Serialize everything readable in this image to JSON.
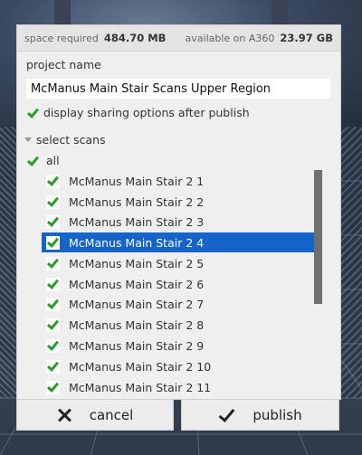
{
  "storage": {
    "required_label": "space required",
    "required_value": "484.70 MB",
    "available_label": "available on A360",
    "available_value": "23.97 GB"
  },
  "project": {
    "label": "project name",
    "value": "McManus Main Stair Scans Upper Region"
  },
  "sharing": {
    "label": "display sharing options after publish",
    "checked": true
  },
  "scans": {
    "header": "select scans",
    "all_label": "all",
    "items": [
      {
        "label": "McManus Main Stair 2 1",
        "checked": true
      },
      {
        "label": "McManus Main Stair 2 2",
        "checked": true
      },
      {
        "label": "McManus Main Stair 2 3",
        "checked": true
      },
      {
        "label": "McManus Main Stair 2 4",
        "checked": true,
        "selected": true
      },
      {
        "label": "McManus Main Stair 2 5",
        "checked": true
      },
      {
        "label": "McManus Main Stair 2 6",
        "checked": true
      },
      {
        "label": "McManus Main Stair 2 7",
        "checked": true
      },
      {
        "label": "McManus Main Stair 2 8",
        "checked": true
      },
      {
        "label": "McManus Main Stair 2 9",
        "checked": true
      },
      {
        "label": "McManus Main Stair 2 10",
        "checked": true
      },
      {
        "label": "McManus Main Stair 2 11",
        "checked": true
      }
    ]
  },
  "buttons": {
    "cancel": "cancel",
    "publish": "publish"
  },
  "colors": {
    "selection": "#1565c8",
    "check": "#2a9a2a",
    "panel": "#efefef"
  }
}
